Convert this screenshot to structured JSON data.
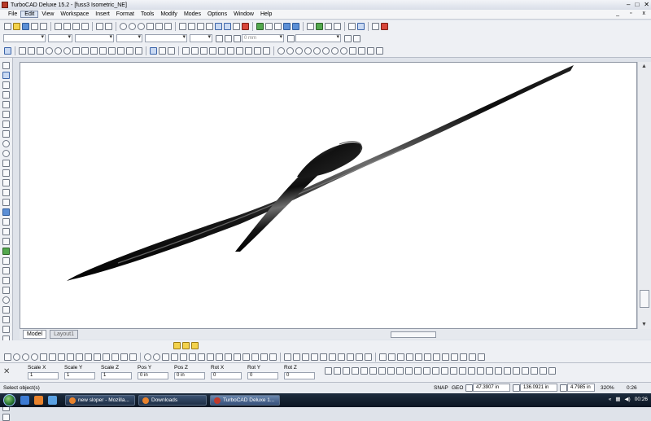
{
  "window": {
    "title": "TurboCAD Deluxe 15.2 - [fuss3 Isometric_NE]"
  },
  "window_controls": {
    "minimize": "–",
    "maximize": "□",
    "close": "✕"
  },
  "mdi_controls": {
    "minimize": "_",
    "restore": "▫",
    "close": "x"
  },
  "menu": {
    "items": [
      "File",
      "Edit",
      "View",
      "Workspace",
      "Insert",
      "Format",
      "Tools",
      "Modify",
      "Modes",
      "Options",
      "Window",
      "Help"
    ],
    "active": "Edit"
  },
  "property_toolbar": {
    "thickness_value": "0 mm"
  },
  "tabs": {
    "model": "Model",
    "layout": "Layout1"
  },
  "inspector": {
    "close": "✕",
    "fields": [
      {
        "label": "Scale X",
        "value": "1"
      },
      {
        "label": "Scale Y",
        "value": "1"
      },
      {
        "label": "Scale Z",
        "value": "1"
      },
      {
        "label": "Pos Y",
        "value": "0 in"
      },
      {
        "label": "Pos Z",
        "value": "0 in"
      },
      {
        "label": "Rot X",
        "value": "0"
      },
      {
        "label": "Rot Y",
        "value": "0"
      },
      {
        "label": "Rot Z",
        "value": "0"
      }
    ]
  },
  "status": {
    "message": "Select object(s)",
    "snap": "SNAP",
    "geo": "GEO",
    "x": "47.3907 in",
    "y": "136.0921 in",
    "z": "4.7985 in",
    "zoom": "320%",
    "value": "0:26"
  },
  "taskbar": {
    "tasks": [
      {
        "label": "new sloper - Mozilla...",
        "icon_color": "#e8822c",
        "active": false
      },
      {
        "label": "Downloads",
        "icon_color": "#e8822c",
        "active": false
      },
      {
        "label": "TurboCAD Deluxe 1...",
        "icon_color": "#c0392b",
        "active": true
      }
    ],
    "clock": "00:26"
  },
  "colors": {
    "accent": "#3a63a8",
    "model": "#111111",
    "canvas": "#ffffff"
  },
  "icons": [
    "app-icon",
    "new-icon",
    "open-icon",
    "save-icon",
    "print-icon",
    "undo-icon",
    "redo-icon",
    "zoom-icon",
    "select-icon",
    "line-icon",
    "circle-icon",
    "arc-icon",
    "text-icon",
    "snap-icon",
    "fillet-icon",
    "box-icon",
    "sphere-icon",
    "extrude-icon",
    "render-icon",
    "layer-icon"
  ]
}
